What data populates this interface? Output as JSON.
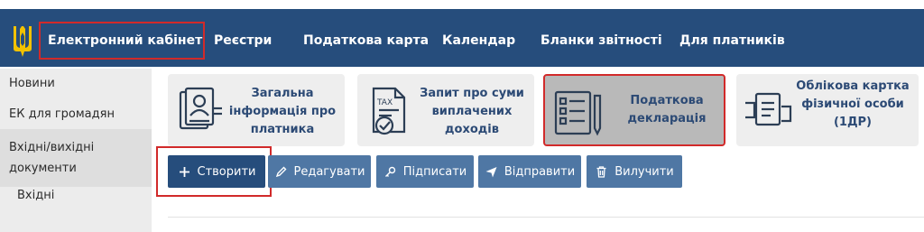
{
  "colors": {
    "header_bg": "#264d7c",
    "accent_border": "#d12a2a",
    "button_bg": "#4f77a4",
    "button_primary_bg": "#264d7c",
    "card_bg": "#eeeeee",
    "card_active_bg": "#b9b9b9",
    "sidebar_bg": "#ececec",
    "card_text": "#2c4a75"
  },
  "header": {
    "logo_icon": "trident-icon",
    "app_title": "Електронний кабінет",
    "nav": [
      {
        "label": "Реєстри"
      },
      {
        "label": "Податкова карта"
      },
      {
        "label": "Календар"
      },
      {
        "label": "Бланки звітності"
      },
      {
        "label": "Для платників"
      }
    ]
  },
  "sidebar": {
    "items": [
      {
        "label": "Новини"
      },
      {
        "label": "ЕК для громадян"
      },
      {
        "label_line1": "Вхідні/вихідні",
        "label_line2": "документи"
      },
      {
        "label": "Вхідні"
      }
    ]
  },
  "cards": [
    {
      "line1": "Загальна",
      "line2": "інформація про",
      "line3": "платника",
      "icon": "taxpayer-profile-icon"
    },
    {
      "line1": "Запит про суми",
      "line2": "виплачених",
      "line3": "доходів",
      "icon": "tax-document-icon"
    },
    {
      "line1": "Податкова",
      "line2": "декларація",
      "icon": "declaration-checklist-icon",
      "selected": true
    },
    {
      "line1": "Облікова картка",
      "line2": "фізичної особи",
      "line3": "(1ДР)",
      "icon": "registration-card-icon"
    }
  ],
  "toolbar": {
    "create": {
      "label": "Створити",
      "icon": "plus-icon"
    },
    "edit": {
      "label": "Редагувати",
      "icon": "pencil-icon"
    },
    "sign": {
      "label": "Підписати",
      "icon": "key-icon"
    },
    "send": {
      "label": "Відправити",
      "icon": "send-icon"
    },
    "delete": {
      "label": "Вилучити",
      "icon": "trash-icon"
    }
  }
}
